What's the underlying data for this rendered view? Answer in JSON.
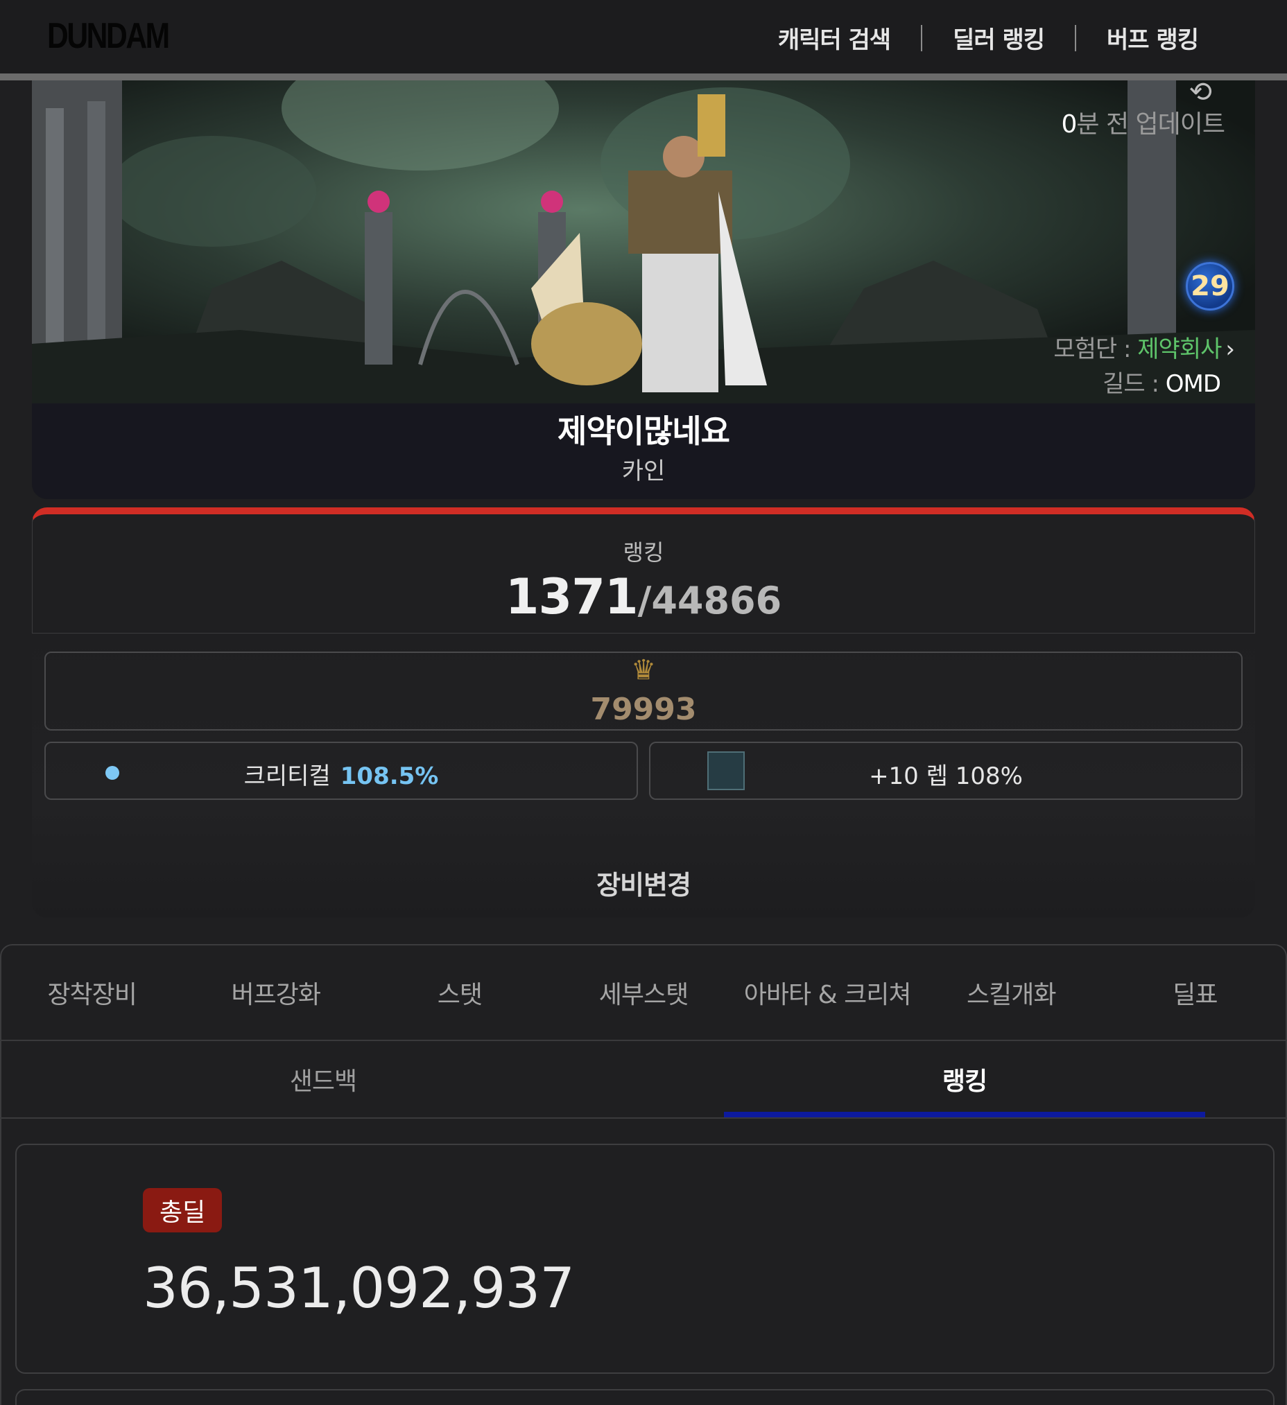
{
  "header": {
    "logo": "DUNDAM",
    "nav": [
      "캐릭터 검색",
      "딜러 랭킹",
      "버프 랭킹"
    ]
  },
  "banner": {
    "update_num": "0",
    "update_text": "분 전 업데이트",
    "level_badge": "29",
    "adventure_label": "모험단 : ",
    "adventure_value": "제약회사",
    "guild_label": "길드 : ",
    "guild_value": "OMD",
    "character_name": "제약이많네요",
    "character_class": "카인"
  },
  "ranking": {
    "label": "랭킹",
    "current": "1371",
    "total": "/44866"
  },
  "stats": {
    "score": "79993",
    "crit_label": "크리티컬",
    "crit_value": "108.5%",
    "weapon_text": "+10 렙 108%"
  },
  "equip_change": "장비변경",
  "tabs": [
    "장착장비",
    "버프강화",
    "스탯",
    "세부스탯",
    "아바타 & 크리쳐",
    "스킬개화",
    "딜표"
  ],
  "sub_tabs": {
    "sandbag": "샌드백",
    "ranking": "랭킹"
  },
  "damage": {
    "badge": "총딜",
    "value": "36,531,092,937"
  },
  "colors": {
    "accent_red": "#d02d25",
    "active_tab_underline": "#0d1a9e",
    "adventure_green": "#5ec46a",
    "crit_blue": "#76c4f2",
    "badge_red": "#8a1a12"
  }
}
